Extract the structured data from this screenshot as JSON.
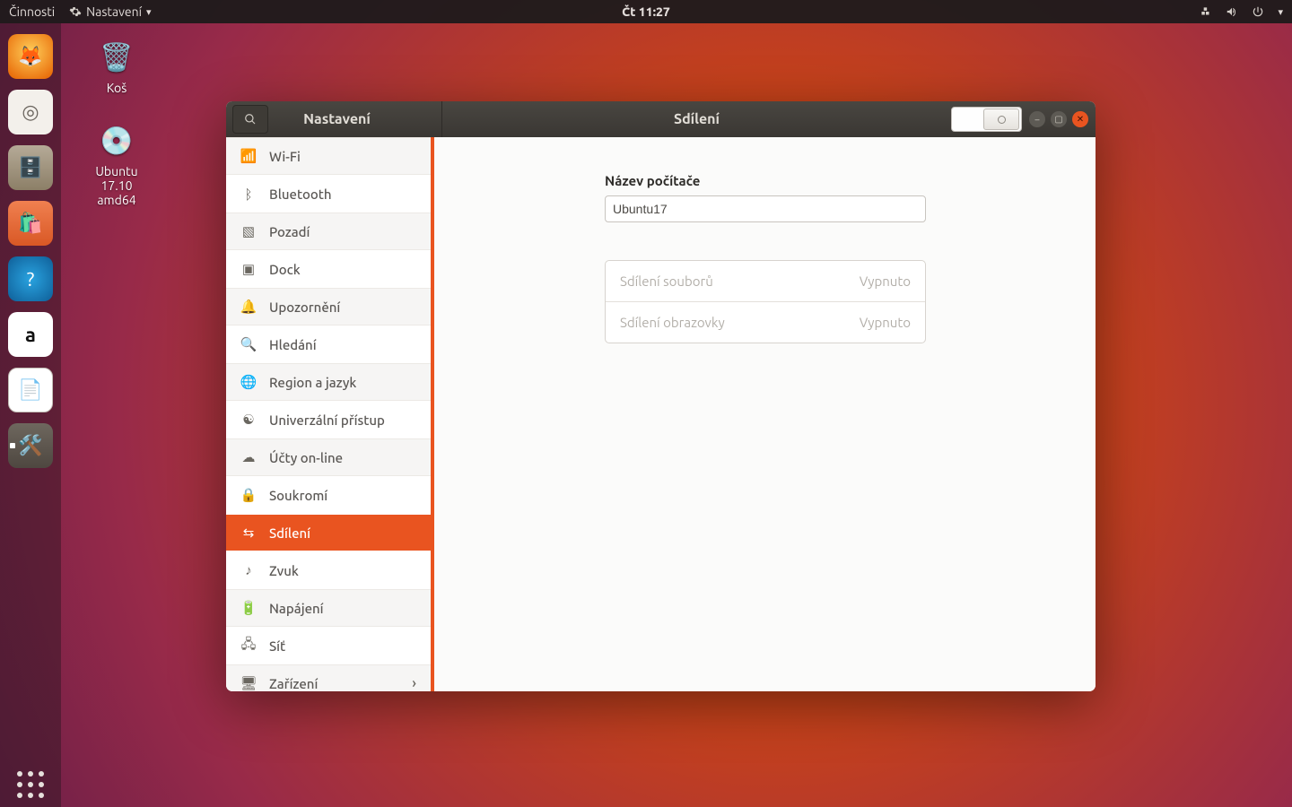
{
  "topbar": {
    "activities": "Činnosti",
    "app_name": "Nastavení",
    "clock": "Čt 11:27"
  },
  "desktop_icons": {
    "trash": "Koš",
    "dvd": "Ubuntu 17.10 amd64"
  },
  "window": {
    "left_title": "Nastavení",
    "right_title": "Sdílení"
  },
  "sidebar": {
    "items": [
      {
        "label": "Wi-Fi"
      },
      {
        "label": "Bluetooth"
      },
      {
        "label": "Pozadí"
      },
      {
        "label": "Dock"
      },
      {
        "label": "Upozornění"
      },
      {
        "label": "Hledání"
      },
      {
        "label": "Region a jazyk"
      },
      {
        "label": "Univerzální přístup"
      },
      {
        "label": "Účty on-line"
      },
      {
        "label": "Soukromí"
      },
      {
        "label": "Sdílení"
      },
      {
        "label": "Zvuk"
      },
      {
        "label": "Napájení"
      },
      {
        "label": "Síť"
      },
      {
        "label": "Zařízení"
      }
    ]
  },
  "panel": {
    "computer_name_label": "Název počítače",
    "computer_name_value": "Ubuntu17",
    "rows": [
      {
        "label": "Sdílení souborů",
        "status": "Vypnuto"
      },
      {
        "label": "Sdílení obrazovky",
        "status": "Vypnuto"
      }
    ]
  }
}
